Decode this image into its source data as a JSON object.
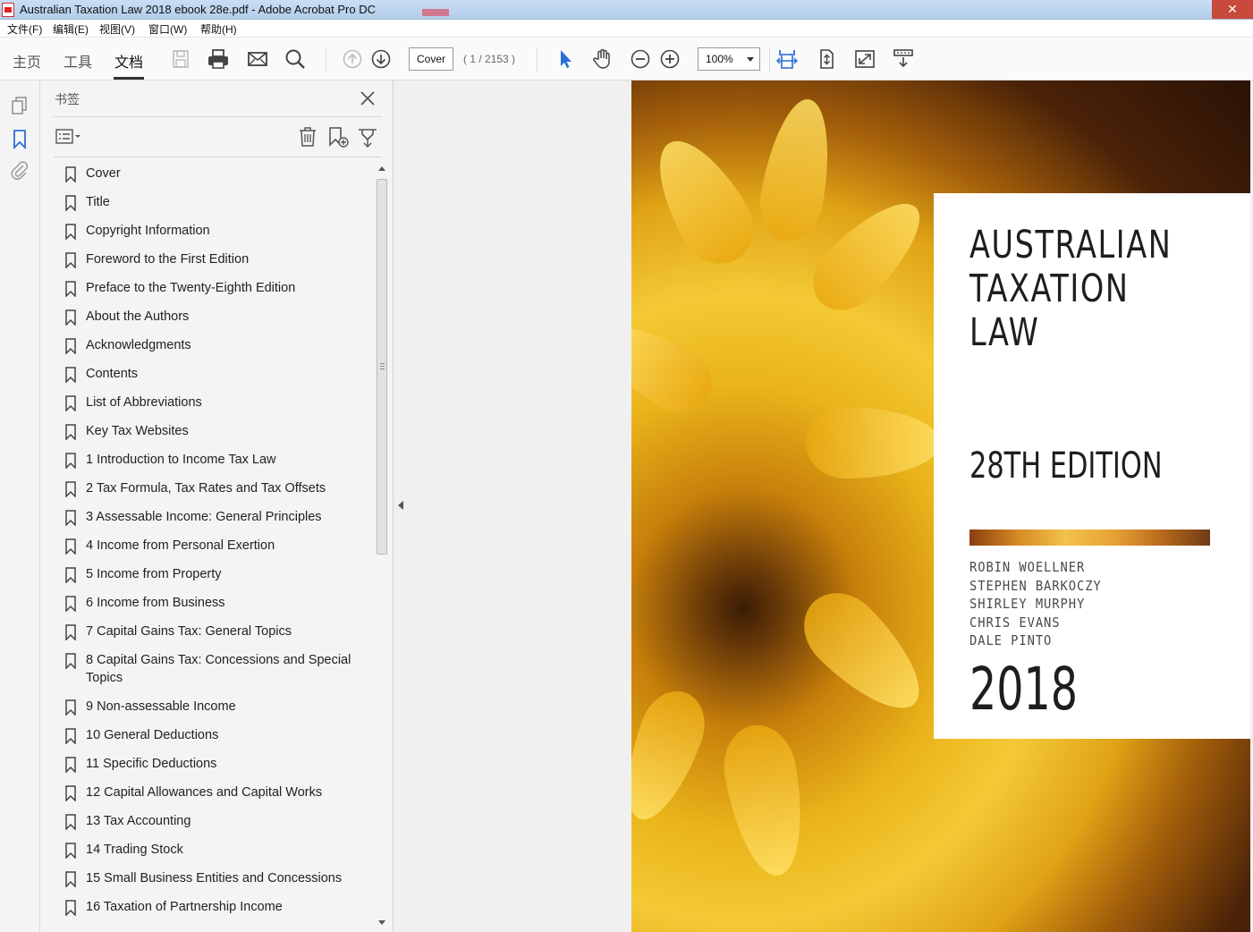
{
  "window": {
    "title": "Australian Taxation Law 2018 ebook 28e.pdf - Adobe Acrobat Pro DC",
    "close_glyph": "✕"
  },
  "menu": [
    "文件(F)",
    "编辑(E)",
    "视图(V)",
    "窗口(W)",
    "帮助(H)"
  ],
  "nav_tabs": [
    "主页",
    "工具",
    "文档"
  ],
  "toolbar": {
    "page_field_value": "Cover",
    "page_count": "( 1 / 2153 )",
    "zoom_value": "100%",
    "icons": [
      "save-icon",
      "print-icon",
      "email-icon",
      "search-icon",
      "prev-page-icon",
      "next-page-icon",
      "select-cursor-icon",
      "hand-tool-icon",
      "zoom-out-icon",
      "zoom-in-icon",
      "fit-width-icon",
      "fit-page-icon",
      "fullscreen-icon",
      "read-mode-icon"
    ]
  },
  "bookmarks_panel": {
    "title": "书签",
    "items": [
      "Cover",
      "Title",
      "Copyright Information",
      "Foreword to the First Edition",
      "Preface to the Twenty-Eighth Edition",
      "About the Authors",
      "Acknowledgments",
      "Contents",
      "List of Abbreviations",
      "Key Tax Websites",
      "1 Introduction to Income Tax Law",
      "2 Tax Formula, Tax Rates and Tax Offsets",
      "3 Assessable Income: General Principles",
      "4 Income from Personal Exertion",
      "5 Income from Property",
      "6 Income from Business",
      "7 Capital Gains Tax: General Topics",
      "8 Capital Gains Tax: Concessions and Special Topics",
      "9 Non-assessable Income",
      "10 General Deductions",
      "11 Specific Deductions",
      "12 Capital Allowances and Capital Works",
      "13 Tax Accounting",
      "14 Trading Stock",
      "15 Small Business Entities and Concessions",
      "16 Taxation of Partnership Income"
    ]
  },
  "cover": {
    "title_line1": "AUSTRALIAN",
    "title_line2": "TAXATION",
    "title_line3": "LAW",
    "edition": "28TH EDITION",
    "authors": [
      "ROBIN WOELLNER",
      "STEPHEN BARKOCZY",
      "SHIRLEY MURPHY",
      "CHRIS EVANS",
      "DALE PINTO"
    ],
    "year": "2018"
  }
}
